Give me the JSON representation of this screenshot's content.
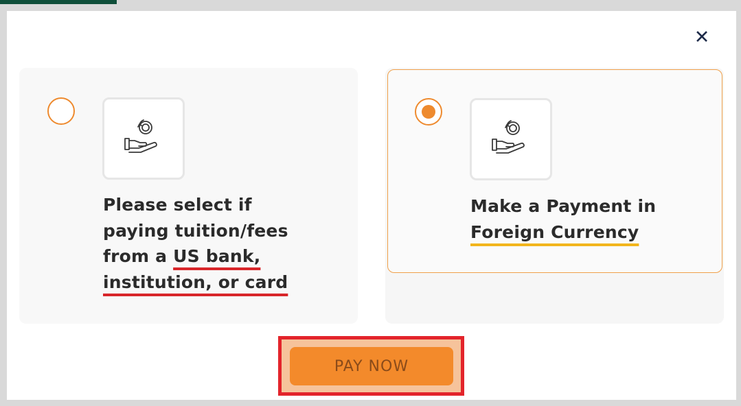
{
  "modal": {
    "close_label": "✕"
  },
  "options": [
    {
      "selected": false,
      "icon": "hand-coin-refresh-icon",
      "lines": [
        "Please select if",
        "paying tuition/fees"
      ],
      "line3_prefix": "from a ",
      "line3_underlined": "US bank,",
      "line4_underlined": "institution, or card"
    },
    {
      "selected": true,
      "icon": "hand-coin-refresh-icon",
      "line1": "Make a Payment in",
      "line2_underlined": "Foreign Currency"
    }
  ],
  "pay_button": {
    "label": "PAY NOW"
  },
  "colors": {
    "accent": "#f38a2b",
    "radio": "#ee8a2e",
    "highlight_box": "#e3242b",
    "red_underline": "#d8262a",
    "yellow_underline": "#f2b51c"
  }
}
